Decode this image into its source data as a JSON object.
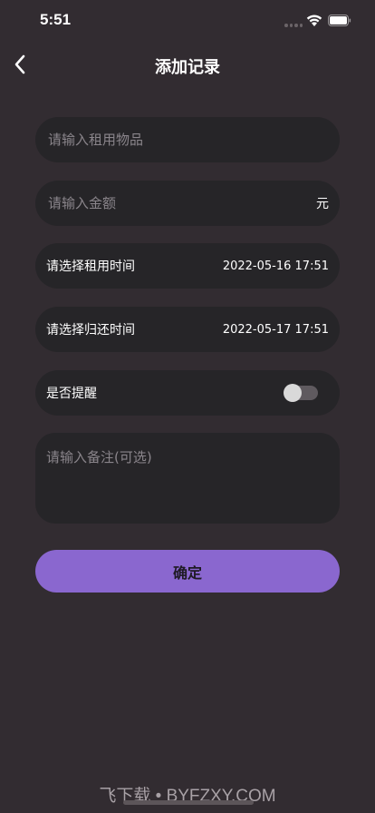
{
  "status_bar": {
    "time": "5:51"
  },
  "nav": {
    "title": "添加记录"
  },
  "form": {
    "item_placeholder": "请输入租用物品",
    "amount_placeholder": "请输入金额",
    "amount_unit": "元",
    "rent_time_label": "请选择租用时间",
    "rent_time_value": "2022-05-16 17:51",
    "return_time_label": "请选择归还时间",
    "return_time_value": "2022-05-17 17:51",
    "reminder_label": "是否提醒",
    "reminder_on": false,
    "notes_placeholder": "请输入备注(可选)",
    "confirm_label": "确定"
  },
  "watermark": "飞下载 • BYFZXY.COM",
  "colors": {
    "accent": "#8a67cf",
    "background": "#322c31",
    "field": "#262528"
  }
}
